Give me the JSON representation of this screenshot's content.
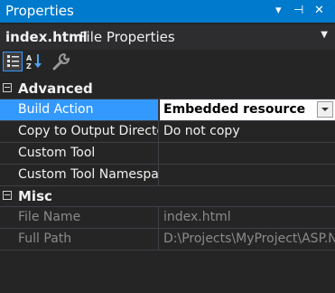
{
  "window": {
    "title": "Properties",
    "controls": {
      "dropdown": "▾",
      "pin": "⊣",
      "close": "✕"
    }
  },
  "object_bar": {
    "name": "index.html",
    "type": "File Properties"
  },
  "toolbar": {
    "buttons": [
      {
        "icon": "categorized-icon",
        "active": true
      },
      {
        "icon": "alphabetical-icon",
        "active": false
      },
      {
        "icon": "wrench-icon",
        "active": false
      }
    ]
  },
  "grid": {
    "categories": [
      {
        "label": "Advanced",
        "rows": [
          {
            "name": "Build Action",
            "value": "Embedded resource"
          },
          {
            "name": "Copy to Output Directo",
            "value": "Do not copy"
          },
          {
            "name": "Custom Tool",
            "value": ""
          },
          {
            "name": "Custom Tool Namespac",
            "value": ""
          }
        ]
      },
      {
        "label": "Misc",
        "rows": [
          {
            "name": "File Name",
            "value": "index.html"
          },
          {
            "name": "Full Path",
            "value": "D:\\Projects\\MyProject\\ASP.N"
          }
        ]
      }
    ]
  },
  "colors": {
    "title_bg": "#007acc",
    "panel_bg": "#252526",
    "selection": "#3399ff"
  }
}
